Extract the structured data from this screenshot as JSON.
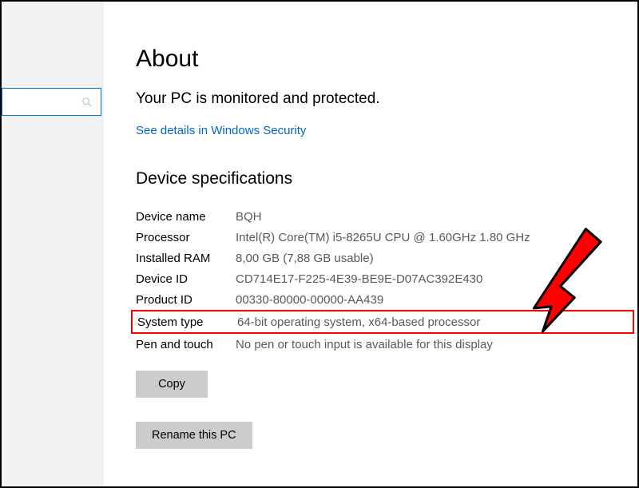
{
  "page_title": "About",
  "status_text": "Your PC is monitored and protected.",
  "security_link": "See details in Windows Security",
  "section_title": "Device specifications",
  "specs": [
    {
      "label": "Device name",
      "value": "BQH"
    },
    {
      "label": "Processor",
      "value": "Intel(R) Core(TM) i5-8265U CPU @ 1.60GHz   1.80 GHz"
    },
    {
      "label": "Installed RAM",
      "value": "8,00 GB (7,88 GB usable)"
    },
    {
      "label": "Device ID",
      "value": "CD714E17-F225-4E39-BE9E-D07AC392E430"
    },
    {
      "label": "Product ID",
      "value": "00330-80000-00000-AA439"
    },
    {
      "label": "System type",
      "value": "64-bit operating system, x64-based processor"
    },
    {
      "label": "Pen and touch",
      "value": "No pen or touch input is available for this display"
    }
  ],
  "buttons": {
    "copy": "Copy",
    "rename": "Rename this PC"
  },
  "search_placeholder": ""
}
